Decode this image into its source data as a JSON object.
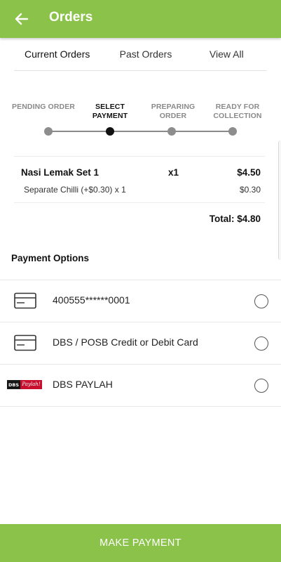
{
  "header": {
    "title": "Orders",
    "back_icon": "arrow-left-icon"
  },
  "tabs": [
    {
      "label": "Current Orders",
      "active": true
    },
    {
      "label": "Past Orders",
      "active": false
    },
    {
      "label": "View All",
      "active": false
    }
  ],
  "stepper": {
    "steps": [
      {
        "label": "PENDING ORDER",
        "active": false
      },
      {
        "label": "SELECT\nPAYMENT",
        "active": true
      },
      {
        "label": "PREPARING\nORDER",
        "active": false
      },
      {
        "label": "READY FOR\nCOLLECTION",
        "active": false
      }
    ]
  },
  "order": {
    "item_name": "Nasi Lemak Set 1",
    "item_qty": "x1",
    "item_price": "$4.50",
    "addon_name": "Separate Chilli (+$0.30) x 1",
    "addon_price": "$0.30",
    "total": "Total: $4.80"
  },
  "payment": {
    "section_title": "Payment Options",
    "options": [
      {
        "label": "400555******0001",
        "icon": "credit-card-icon",
        "selected": false
      },
      {
        "label": "DBS / POSB Credit or Debit Card",
        "icon": "credit-card-icon",
        "selected": false
      },
      {
        "label": "DBS PAYLAH",
        "icon": "dbs-paylah-logo",
        "logo_text_left": "DBS",
        "logo_text_right": "Paylah!",
        "selected": false
      }
    ]
  },
  "action": {
    "button_label": "MAKE PAYMENT"
  },
  "colors": {
    "primary": "#8bc34a",
    "text": "#222222",
    "muted": "#8a8a8a"
  }
}
